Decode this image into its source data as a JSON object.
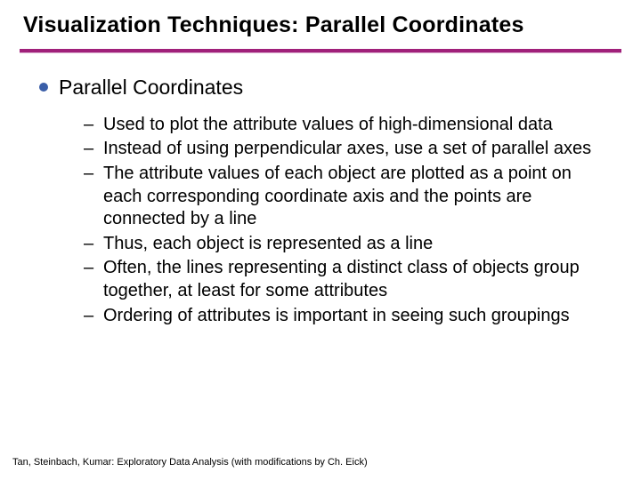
{
  "title": "Visualization Techniques: Parallel Coordinates",
  "content": {
    "heading": "Parallel Coordinates",
    "bullets": [
      "Used to plot the attribute values of high-dimensional data",
      "Instead of using perpendicular axes, use a set of parallel axes",
      "The attribute values of each object are plotted as a point on each corresponding coordinate axis and the points are connected by a line",
      "Thus, each object is represented as a line",
      "Often, the lines representing a distinct class of objects group together, at least for some attributes",
      "Ordering of attributes is important in seeing such groupings"
    ]
  },
  "footer": "Tan, Steinbach, Kumar: Exploratory Data Analysis (with modifications by Ch. Eick)"
}
